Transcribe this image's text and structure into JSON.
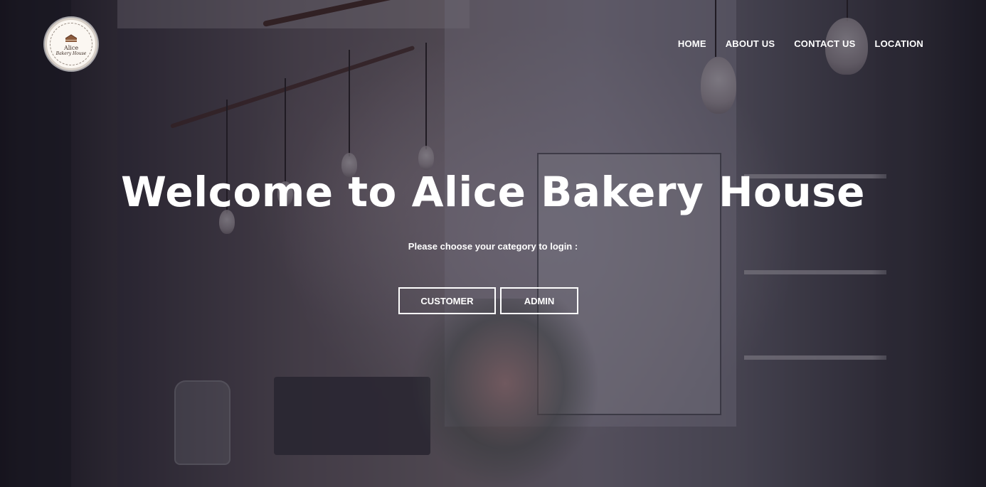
{
  "brand": {
    "logo_line1": "Alice",
    "logo_line2": "Bakery House"
  },
  "nav": {
    "items": [
      {
        "label": "HOME"
      },
      {
        "label": "ABOUT US"
      },
      {
        "label": "CONTACT US"
      },
      {
        "label": "LOCATION"
      }
    ]
  },
  "hero": {
    "title": "Welcome to Alice Bakery House",
    "subtitle": "Please choose your category to login :",
    "buttons": {
      "customer": "CUSTOMER",
      "admin": "ADMIN"
    }
  },
  "colors": {
    "text": "#ffffff",
    "overlay": "#161422"
  }
}
